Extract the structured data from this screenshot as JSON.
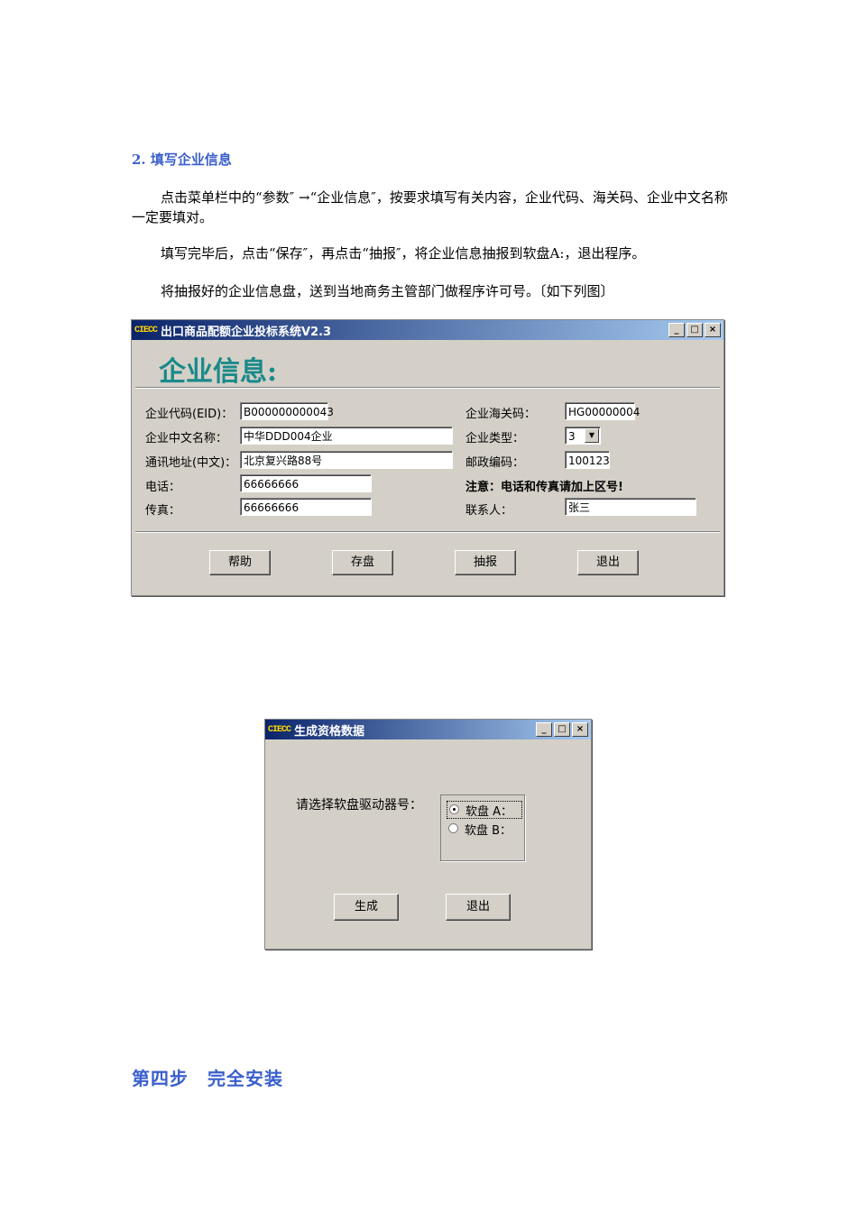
{
  "doc": {
    "heading": "2. 填写企业信息",
    "para1": "点击菜单栏中的“参数″ →“企业信息″，按要求填写有关内容，企业代码、海关码、企业中文名称一定要填对。",
    "para2": "填写完毕后，点击“保存″，再点击“抽报″，将企业信息抽报到软盘A:，退出程序。",
    "para3": "将抽报好的企业信息盘，送到当地商务主管部门做程序许可号。〔如下列图〕",
    "step_heading": "第四步　完全安装"
  },
  "win1": {
    "logo": "CIECC",
    "title": "出口商品配额企业投标系统V2.3",
    "header": "企业信息:",
    "labels": {
      "eid": "企业代码(EID)：",
      "cn_name": "企业中文名称：",
      "address": "通讯地址(中文)：",
      "phone": "电话：",
      "fax": "传真：",
      "customs": "企业海关码：",
      "type": "企业类型：",
      "postal": "邮政编码：",
      "notice": "注意：电话和传真请加上区号!",
      "contact": "联系人："
    },
    "values": {
      "eid": "B000000000043",
      "cn_name": "中华DDD004企业",
      "address": "北京复兴路88号",
      "phone": "66666666",
      "fax": "66666666",
      "customs": "HG00000004",
      "type": "3",
      "postal": "100123",
      "contact": "张三"
    },
    "buttons": {
      "help": "帮助",
      "save": "存盘",
      "extract": "抽报",
      "exit": "退出"
    }
  },
  "win2": {
    "logo": "CIECC",
    "title": "生成资格数据",
    "prompt": "请选择软盘驱动器号：",
    "option_a": "软盘 A：",
    "option_b": "软盘 B：",
    "selected": "软盘 A：",
    "buttons": {
      "generate": "生成",
      "exit": "退出"
    }
  },
  "titlebar_buttons": {
    "minimize": "_",
    "maximize": "□",
    "close": "×"
  },
  "colors": {
    "heading": "#3a5fcd",
    "window_header": "#1a8a8a",
    "titlebar_start": "#0a246a",
    "window_bg": "#d4d0c8"
  }
}
